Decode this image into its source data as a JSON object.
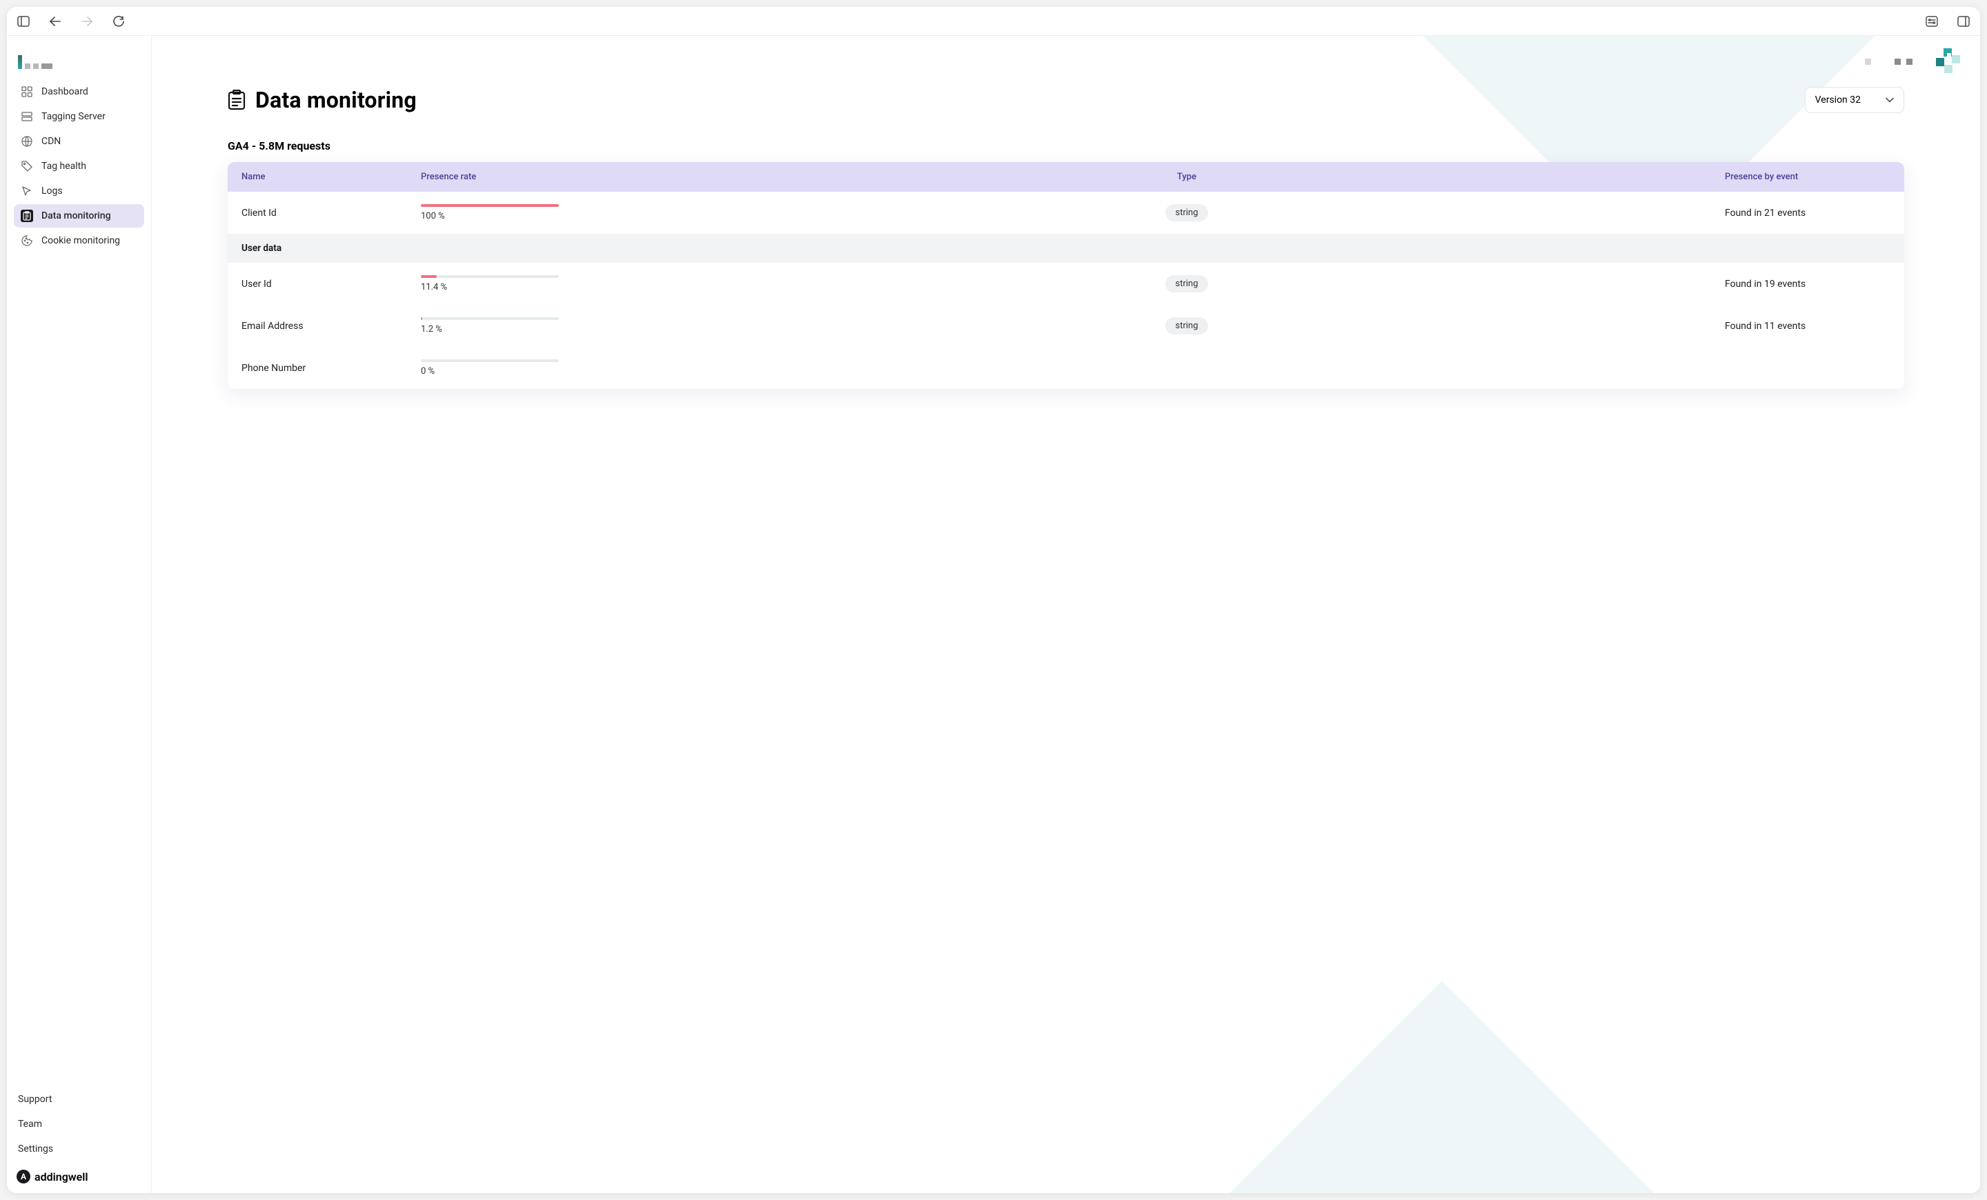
{
  "sidebar": {
    "items": [
      {
        "label": "Dashboard"
      },
      {
        "label": "Tagging Server"
      },
      {
        "label": "CDN"
      },
      {
        "label": "Tag health"
      },
      {
        "label": "Logs"
      },
      {
        "label": "Data monitoring"
      },
      {
        "label": "Cookie monitoring"
      }
    ],
    "footer": {
      "support": "Support",
      "team": "Team",
      "settings": "Settings"
    },
    "brand": "addingwell"
  },
  "page": {
    "title": "Data monitoring",
    "section": "GA4 - 5.8M requests"
  },
  "version_select": {
    "label": "Version 32"
  },
  "table": {
    "headers": {
      "name": "Name",
      "presence_rate": "Presence rate",
      "type": "Type",
      "presence_by_event": "Presence by event"
    },
    "rows": [
      {
        "name": "Client Id",
        "rate_pct": 100,
        "rate_label": "100 %",
        "type": "string",
        "events": "Found in 21 events"
      }
    ],
    "group_label": "User data",
    "group_rows": [
      {
        "name": "User Id",
        "rate_pct": 11.4,
        "rate_label": "11.4 %",
        "type": "string",
        "events": "Found in 19 events"
      },
      {
        "name": "Email Address",
        "rate_pct": 1.2,
        "rate_label": "1.2 %",
        "type": "string",
        "events": "Found in 11 events"
      },
      {
        "name": "Phone Number",
        "rate_pct": 0,
        "rate_label": "0 %",
        "type": "",
        "events": ""
      }
    ]
  }
}
